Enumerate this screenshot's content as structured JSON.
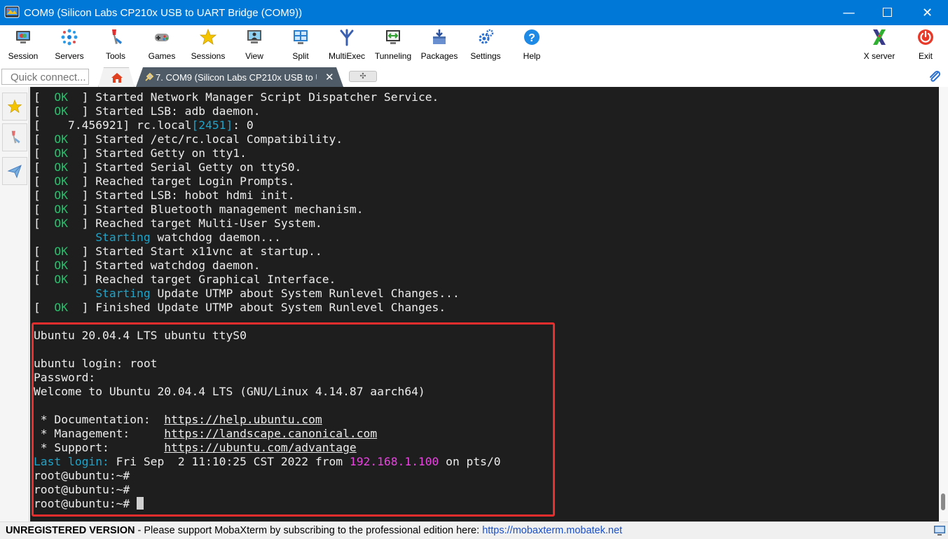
{
  "window": {
    "title": "COM9  (Silicon Labs CP210x USB to UART Bridge (COM9))",
    "minimize": "—",
    "maximize": "☐",
    "close": "✕"
  },
  "toolbar": [
    {
      "label": "Session",
      "icon": "session-icon"
    },
    {
      "label": "Servers",
      "icon": "servers-icon"
    },
    {
      "label": "Tools",
      "icon": "tools-icon"
    },
    {
      "label": "Games",
      "icon": "games-icon"
    },
    {
      "label": "Sessions",
      "icon": "star-icon"
    },
    {
      "label": "View",
      "icon": "view-icon"
    },
    {
      "label": "Split",
      "icon": "split-icon"
    },
    {
      "label": "MultiExec",
      "icon": "multiexec-icon"
    },
    {
      "label": "Tunneling",
      "icon": "tunneling-icon"
    },
    {
      "label": "Packages",
      "icon": "packages-icon"
    },
    {
      "label": "Settings",
      "icon": "settings-icon"
    },
    {
      "label": "Help",
      "icon": "help-icon"
    },
    {
      "label": "X server",
      "icon": "xserver-icon"
    },
    {
      "label": "Exit",
      "icon": "power-icon"
    }
  ],
  "tabs": {
    "quick_connect_placeholder": "Quick connect...",
    "session_tab_label": "7. COM9  (Silicon Labs CP210x USB to UART Bridge (COM9))",
    "close_glyph": "✕",
    "new_tab_glyph": "✣"
  },
  "sidebar": [
    {
      "name": "sidebar-sessions-star",
      "icon": "star-icon"
    },
    {
      "name": "sidebar-tools",
      "icon": "tools-icon"
    },
    {
      "name": "sidebar-macros",
      "icon": "send-icon"
    }
  ],
  "terminal": {
    "ok_word": "OK",
    "boot_lines": [
      {
        "kind": "ok",
        "text": "Started Network Manager Script Dispatcher Service."
      },
      {
        "kind": "ok",
        "text": "Started LSB: adb daemon."
      },
      {
        "kind": "log",
        "time": "7.456921",
        "proc": "rc.local",
        "pid": "[2451]",
        "rest": ": 0"
      },
      {
        "kind": "ok",
        "text": "Started /etc/rc.local Compatibility."
      },
      {
        "kind": "ok",
        "text": "Started Getty on tty1."
      },
      {
        "kind": "ok",
        "text": "Started Serial Getty on ttyS0."
      },
      {
        "kind": "ok",
        "text": "Reached target Login Prompts."
      },
      {
        "kind": "ok",
        "text": "Started LSB: hobot hdmi init."
      },
      {
        "kind": "ok",
        "text": "Started Bluetooth management mechanism."
      },
      {
        "kind": "ok",
        "text": "Reached target Multi-User System."
      },
      {
        "kind": "starting",
        "word": "Starting",
        "text": "watchdog daemon..."
      },
      {
        "kind": "ok",
        "text": "Started Start x11vnc at startup.."
      },
      {
        "kind": "ok",
        "text": "Started watchdog daemon."
      },
      {
        "kind": "ok",
        "text": "Reached target Graphical Interface."
      },
      {
        "kind": "starting",
        "word": "Starting",
        "text": "Update UTMP about System Runlevel Changes..."
      },
      {
        "kind": "ok",
        "text": "Finished Update UTMP about System Runlevel Changes."
      }
    ],
    "banner": "Ubuntu 20.04.4 LTS ubuntu ttyS0",
    "login_line": "ubuntu login: root",
    "password_line": "Password:",
    "welcome_line": "Welcome to Ubuntu 20.04.4 LTS (GNU/Linux 4.14.87 aarch64)",
    "docs": [
      {
        "label": " * Documentation:  ",
        "url": "https://help.ubuntu.com"
      },
      {
        "label": " * Management:     ",
        "url": "https://landscape.canonical.com"
      },
      {
        "label": " * Support:        ",
        "url": "https://ubuntu.com/advantage"
      }
    ],
    "last_login": {
      "label": "Last login:",
      "when": " Fri Sep  2 11:10:25 CST 2022 from ",
      "ip": "192.168.1.100",
      "tail": " on pts/0"
    },
    "prompt": "root@ubuntu:~#",
    "accent_ok": "#27c16a",
    "accent_cyan": "#1fa4c9",
    "accent_magenta": "#e844e0",
    "highlight_color": "#ec2d2d"
  },
  "status": {
    "unregistered": "UNREGISTERED VERSION",
    "message": "  -  Please support MobaXterm by subscribing to the professional edition here:  ",
    "link": "https://mobaxterm.mobatek.net"
  }
}
